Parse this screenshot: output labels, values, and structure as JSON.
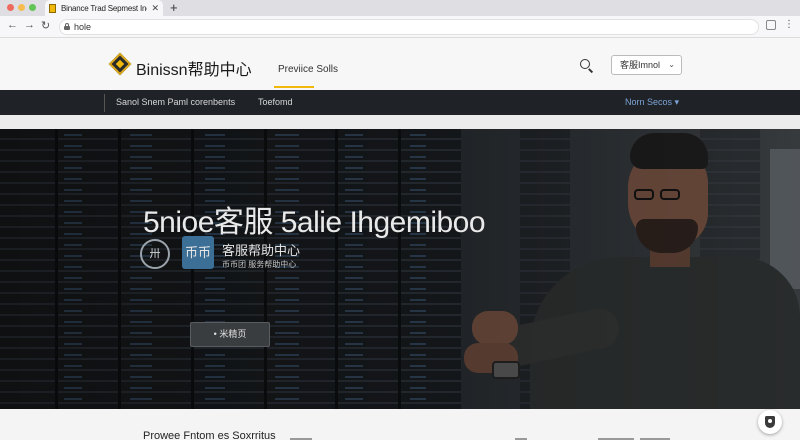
{
  "browser": {
    "tab_title": "Binance Trad Sepmest Inel",
    "tab_close": "✕",
    "new_tab": "+",
    "address": "hole",
    "back": "←",
    "forward": "→",
    "reload": "↻",
    "menu": "⋮"
  },
  "header": {
    "brand": "Binissn帮助中心",
    "link": "Previice Solls",
    "language": "客服Imnol",
    "language_chevron": "⌄"
  },
  "nav": {
    "items": [
      "Sanol Snem Paml corenbents",
      "Toefomd"
    ],
    "right": "Norn Secos ▾"
  },
  "hero": {
    "title": "5nioe客服 5alie Ihgemiboo",
    "badge": "卅",
    "logo_box": "币币",
    "subtitle": "客服帮助中心",
    "small": "币币团 服务帮助中心",
    "button": "• 米精页"
  },
  "footer": {
    "section_title": "Prowee Fntom es Soxrritus"
  },
  "colors": {
    "accent": "#f0b90b",
    "navbar": "#1f2226",
    "hero_logo": "#3c6f95"
  }
}
